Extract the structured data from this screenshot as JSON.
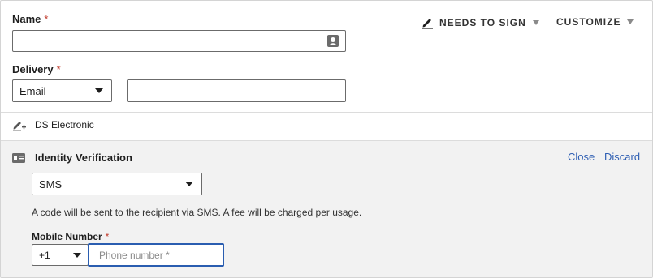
{
  "form": {
    "name_label": "Name",
    "name_value": "",
    "delivery_label": "Delivery",
    "delivery_selected": "Email",
    "delivery_value": "",
    "required_mark": "*"
  },
  "toolbar": {
    "needs_to_sign": "NEEDS TO SIGN",
    "customize": "CUSTOMIZE"
  },
  "signature_type": {
    "label": "DS Electronic"
  },
  "identity_verification": {
    "title": "Identity Verification",
    "close_label": "Close",
    "discard_label": "Discard",
    "method_selected": "SMS",
    "help_text": "A code will be sent to the recipient via SMS. A fee will be charged per usage.",
    "mobile_label": "Mobile Number",
    "country_code": "+1",
    "phone_placeholder": "Phone number *",
    "phone_value": ""
  },
  "colors": {
    "link": "#2f5fb3",
    "required": "#c0392b",
    "focus_border": "#2a5db0",
    "panel_bg": "#f2f2f2"
  },
  "icons": {
    "contacts": "contact-card-icon",
    "signer": "pen-icon",
    "ds_electronic": "pen-plus-icon",
    "id_card": "id-card-icon"
  }
}
